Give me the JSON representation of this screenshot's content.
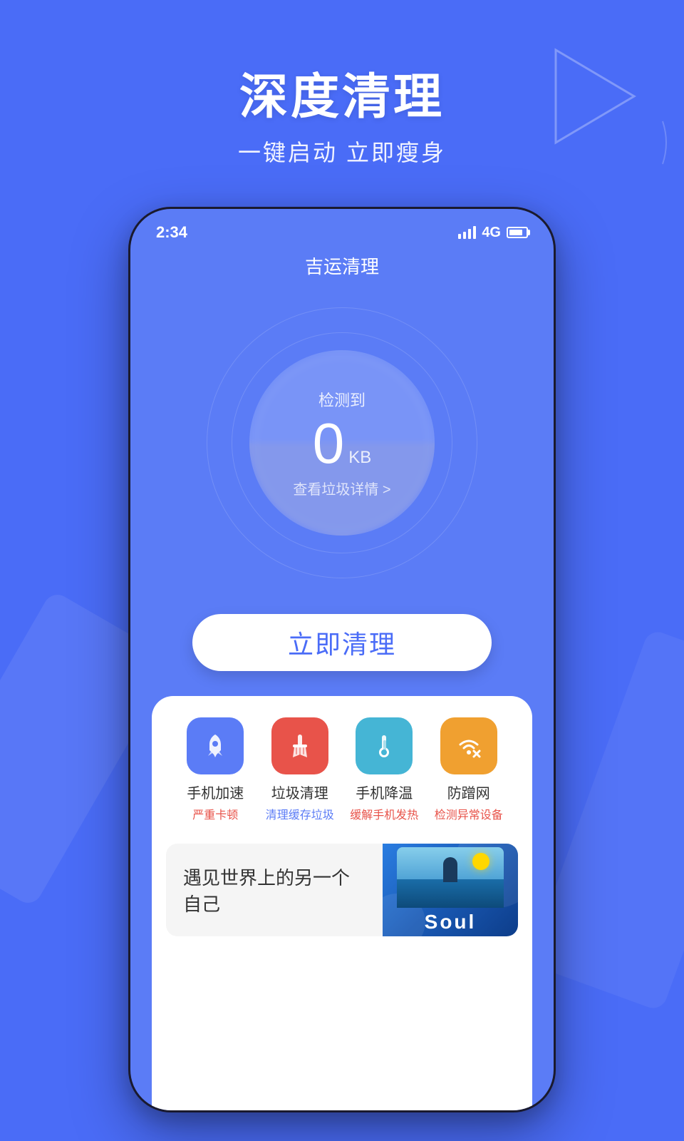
{
  "background": {
    "color": "#4a6cf7"
  },
  "header": {
    "main_title": "深度清理",
    "sub_title": "一键启动 立即瘦身"
  },
  "phone": {
    "status_bar": {
      "time": "2:34",
      "signal": "4G",
      "battery": "80"
    },
    "app_title": "吉运清理",
    "gauge": {
      "label": "检测到",
      "value": "0",
      "unit": "KB",
      "detail": "查看垃圾详情 >"
    },
    "clean_button": "立即清理",
    "features": [
      {
        "name": "手机加速",
        "desc": "严重卡顿",
        "icon_type": "rocket",
        "icon_color": "blue",
        "desc_color": "red"
      },
      {
        "name": "垃圾清理",
        "desc": "清理缓存垃圾",
        "icon_type": "broom",
        "icon_color": "red",
        "desc_color": "blue"
      },
      {
        "name": "手机降温",
        "desc": "缓解手机发热",
        "icon_type": "thermometer",
        "icon_color": "cyan",
        "desc_color": "red"
      },
      {
        "name": "防蹭网",
        "desc": "检测异常设备",
        "icon_type": "wifi",
        "icon_color": "orange",
        "desc_color": "red"
      }
    ],
    "ad_banner": {
      "text": "遇见世界上的另一个自己",
      "app_name": "Soul"
    }
  }
}
